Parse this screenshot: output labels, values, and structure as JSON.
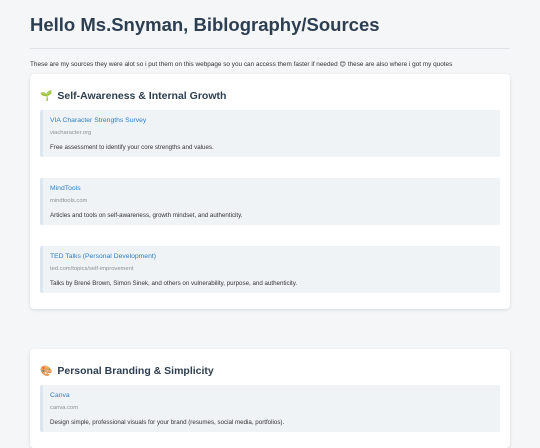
{
  "page": {
    "title": "Hello Ms.Snyman, Biblography/Sources",
    "intro": "These are my sources they were alot so i put them on this webpage so you can access them faster if needed 😊 these are also where i got my quotes"
  },
  "sections": [
    {
      "emoji": "🌱",
      "heading": "Self-Awareness & Internal Growth",
      "sources": [
        {
          "name": "VIA Character Strengths Survey",
          "url": "viacharacter.org",
          "desc": "Free assessment to identify your core strengths and values."
        },
        {
          "name": "MindTools",
          "url": "mindtools.com",
          "desc": "Articles and tools on self-awareness, growth mindset, and authenticity."
        },
        {
          "name": "TED Talks (Personal Development)",
          "url": "ted.com/topics/self-improvement",
          "desc": "Talks by Brené Brown, Simon Sinek, and others on vulnerability, purpose, and authenticity."
        }
      ]
    },
    {
      "emoji": "🎨",
      "heading": "Personal Branding & Simplicity",
      "sources": [
        {
          "name": "Canva",
          "url": "canva.com",
          "desc": "Design simple, professional visuals for your brand (resumes, social media, portfolios)."
        }
      ]
    }
  ],
  "colors": {
    "link": "#2d7fcb",
    "heading": "#2c3e50",
    "background": "#f4f6f8"
  }
}
